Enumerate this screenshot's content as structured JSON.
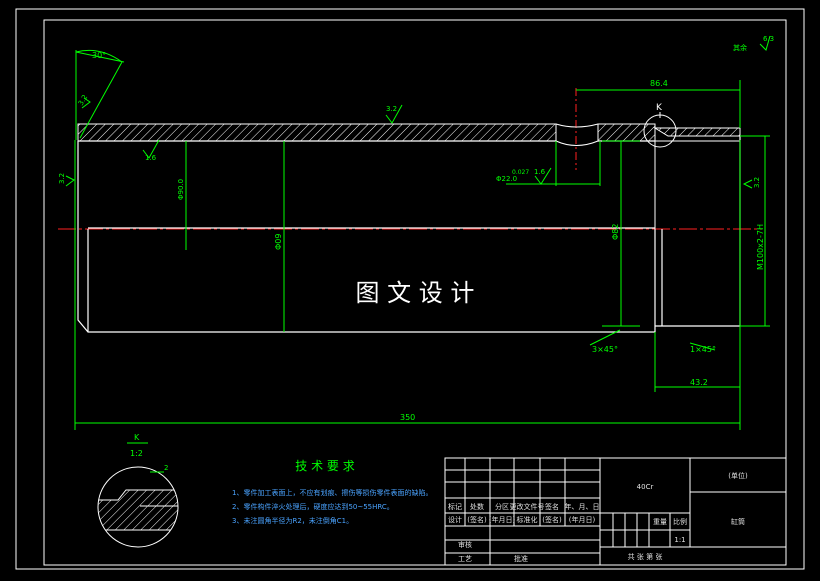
{
  "drawing": {
    "watermark": "图 文 设 计",
    "dimensions": {
      "angle": "30°",
      "thread_len": "86.4",
      "total_len": "350",
      "tail_len": "43.2",
      "dia_big": "Φ09",
      "dia_mid": "Φ82",
      "dia_small": "Φ22.0",
      "dia_hole": "Φ90.0",
      "thread": "M100x2-7H",
      "chamfer_left": "3×45°",
      "chamfer_right": "1×45°",
      "tol": "0.027"
    },
    "roughness": {
      "corner_val": "6.3",
      "corner_label": "其余",
      "top": "3.2",
      "left_top": "1.6",
      "left_mid": "3.2",
      "groove": "1.6",
      "right": "3.2",
      "outer": "3.2"
    },
    "detail": {
      "label": "K",
      "scale": "1:2",
      "dim": "2"
    },
    "view_label": "K"
  },
  "requirements": {
    "title": "技 术 要 求",
    "items": [
      "1、零件加工表面上，不应有划痕、擦伤等损伤零件表面的缺陷。",
      "2、零件构件淬火处理后，硬度应达到50~55HRC。",
      "3、未注圆角半径为R2，未注倒角C1。"
    ]
  },
  "title_block": {
    "material": "40Cr",
    "org": "(单位)",
    "part_name": "缸筒",
    "row1": [
      "标记",
      "处数",
      "分区",
      "更改文件号",
      "签名",
      "年、月、日"
    ],
    "row2": [
      "设计",
      "(签名)",
      "(年月日)",
      "标准化",
      "(签名)",
      "(年月日)"
    ],
    "h_weight": "重量",
    "h_scale": "比例",
    "scale_val": "1:1",
    "review": "审核",
    "process": "工艺",
    "approve": "批准",
    "sheets": "共    张  第    张"
  }
}
